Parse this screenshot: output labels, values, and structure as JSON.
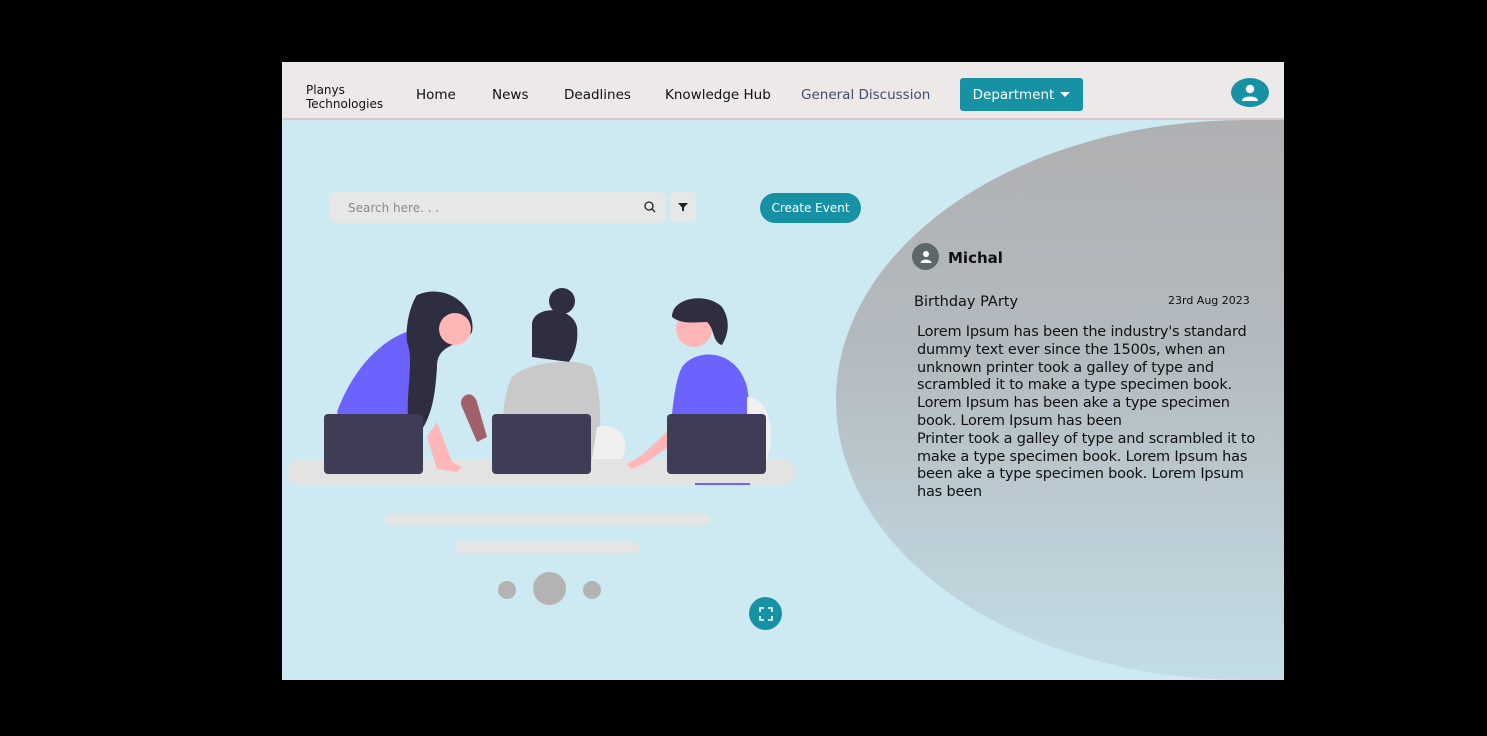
{
  "navbar": {
    "brand_line1": "Planys",
    "brand_line2": "Technologies",
    "links": [
      "Home",
      "News",
      "Deadlines",
      "Knowledge Hub",
      "General Discussion"
    ],
    "department_label": "Department",
    "icons": {
      "profile": "user-circle-icon",
      "caret": "caret-down-icon"
    }
  },
  "toolbar": {
    "search_placeholder": "Search here. . .",
    "create_event_label": "Create Event",
    "icons": {
      "search": "search-icon",
      "filter": "filter-icon"
    }
  },
  "carousel": {
    "slide_count": 3,
    "active_index": 1,
    "expand_icon": "expand-icon"
  },
  "post": {
    "user": "Michal",
    "title": "Birthday PArty",
    "date": "23rd Aug 2023",
    "paragraph1": "Lorem Ipsum has been the industry's standard dummy text ever since the 1500s, when an unknown printer took a galley of type and scrambled it to make a type specimen book. Lorem Ipsum has been ake a type specimen book. Lorem Ipsum has been",
    "paragraph2": "Printer took a galley of type and scrambled it to make a type specimen book. Lorem Ipsum has been ake a type specimen book. Lorem Ipsum has been"
  },
  "colors": {
    "accent": "#1792a4",
    "background": "#cde9f2",
    "navbar": "#ece9e8",
    "illustration_purple": "#6c63ff",
    "laptop": "#3f3d56"
  }
}
